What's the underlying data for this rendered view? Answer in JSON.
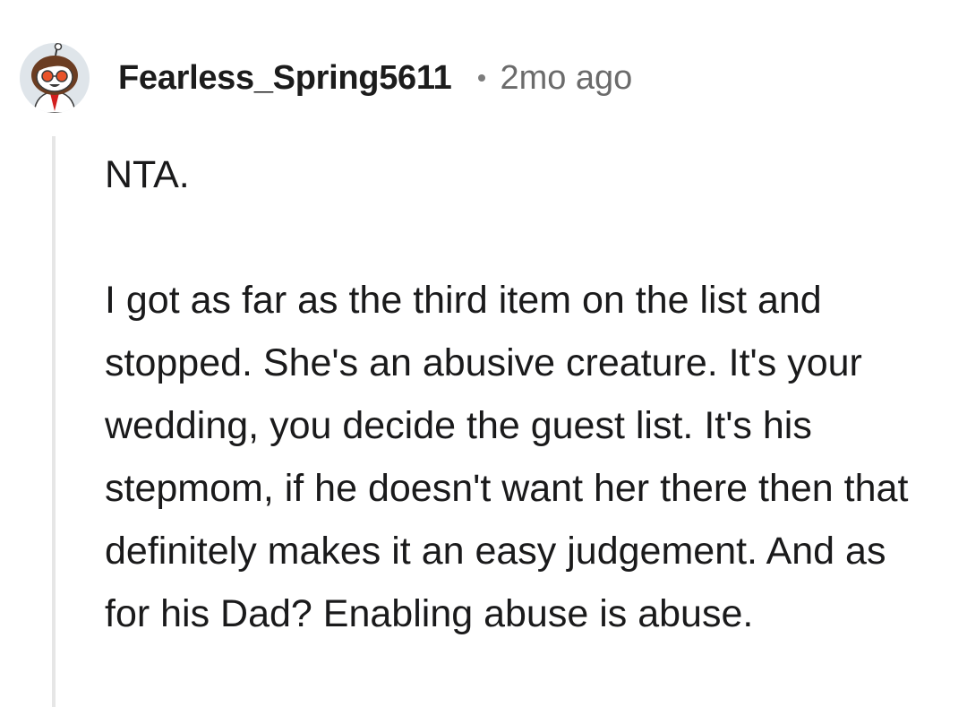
{
  "comment": {
    "author": "Fearless_Spring5611",
    "timestamp": "2mo ago",
    "paragraphs": [
      "NTA.",
      "I got as far as the third item on the list and stopped. She's an abusive creature. It's your wedding, you decide the guest list. It's his stepmom, if he doesn't want her there then that definitely makes it an easy judgement. And as for his Dad? Enabling abuse is abuse."
    ]
  },
  "icons": {
    "avatar": "user-avatar-icon",
    "separator": "dot-separator-icon"
  },
  "colors": {
    "text": "#1a1a1b",
    "meta": "#6b6b6b",
    "thread_line": "#e6e6e6",
    "avatar_bg": "#dfe5ea"
  }
}
